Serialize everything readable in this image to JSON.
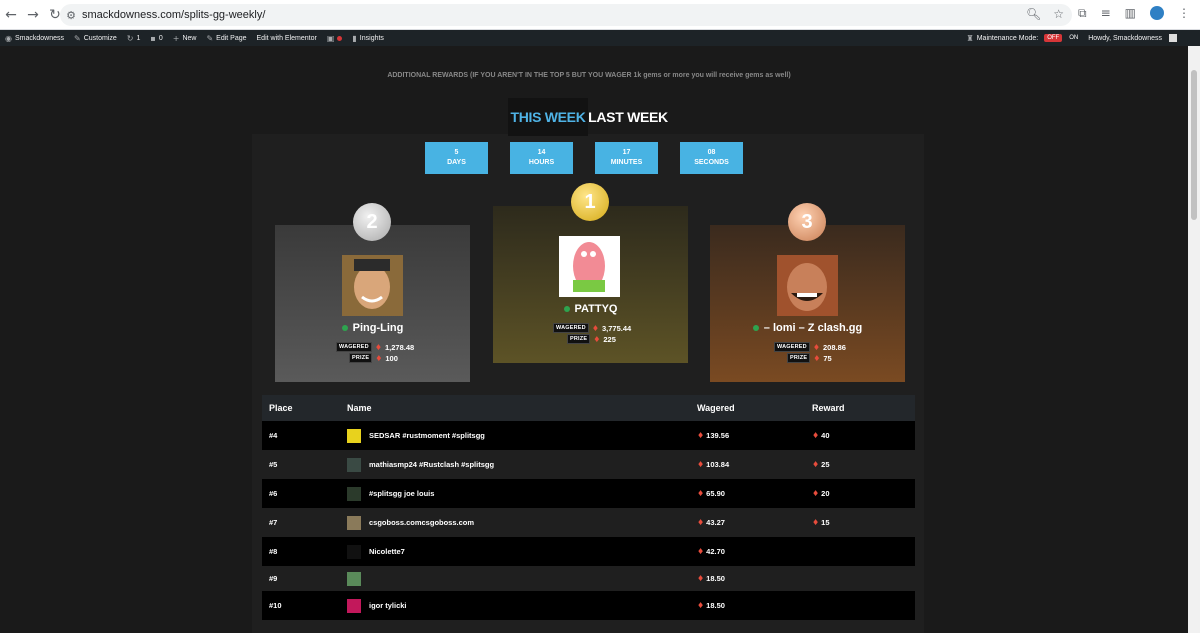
{
  "browser": {
    "url": "smackdowness.com/splits-gg-weekly/",
    "back_glyph": "←",
    "forward_glyph": "→",
    "reload_glyph": "↻"
  },
  "adminbar": {
    "site": "Smackdowness",
    "customize": "Customize",
    "updates": "1",
    "comments": "0",
    "new": "New",
    "edit_page": "Edit Page",
    "edit_elementor": "Edit with Elementor",
    "insights": "Insights",
    "maintenance_label": "Maintenance Mode:",
    "maintenance_off": "OFF",
    "maintenance_on": "ON",
    "howdy": "Howdy, Smackdowness"
  },
  "notice": "ADDITIONAL REWARDS (IF YOU AREN'T IN THE TOP 5 BUT YOU WAGER 1k gems or more you will receive gems as well)",
  "tabs": {
    "this_week": "THIS WEEK",
    "last_week": "LAST WEEK"
  },
  "countdown": [
    {
      "value": "5",
      "unit": "DAYS"
    },
    {
      "value": "14",
      "unit": "HOURS"
    },
    {
      "value": "17",
      "unit": "MINUTES"
    },
    {
      "value": "08",
      "unit": "SECONDS"
    }
  ],
  "podium": {
    "first": {
      "rank": "1",
      "name": "PATTYQ",
      "wagered_label": "WAGERED",
      "wagered": "3,775.44",
      "prize_label": "PRIZE",
      "prize": "225"
    },
    "second": {
      "rank": "2",
      "name": "Ping-Ling",
      "wagered_label": "WAGERED",
      "wagered": "1,278.48",
      "prize_label": "PRIZE",
      "prize": "100"
    },
    "third": {
      "rank": "3",
      "name": "– lomi – Z clash.gg",
      "wagered_label": "WAGERED",
      "wagered": "208.86",
      "prize_label": "PRIZE",
      "prize": "75"
    }
  },
  "table": {
    "headers": {
      "place": "Place",
      "name": "Name",
      "wagered": "Wagered",
      "reward": "Reward"
    },
    "rows": [
      {
        "place": "#4",
        "name": "SEDSAR #rustmoment #splitsgg",
        "wagered": "139.56",
        "reward": "40",
        "avatar_color": "#e8d21d"
      },
      {
        "place": "#5",
        "name": "mathiasmp24 #Rustclash #splitsgg",
        "wagered": "103.84",
        "reward": "25",
        "avatar_color": "#3a4a44"
      },
      {
        "place": "#6",
        "name": "#splitsgg joe louis",
        "wagered": "65.90",
        "reward": "20",
        "avatar_color": "#2b3a2b"
      },
      {
        "place": "#7",
        "name": "csgoboss.comcsgoboss.com",
        "wagered": "43.27",
        "reward": "15",
        "avatar_color": "#8a7a5a"
      },
      {
        "place": "#8",
        "name": "Nicolette7",
        "wagered": "42.70",
        "reward": "",
        "avatar_color": "#111111"
      },
      {
        "place": "#9",
        "name": "",
        "wagered": "18.50",
        "reward": "",
        "avatar_color": "#5a8a5a"
      },
      {
        "place": "#10",
        "name": "igor tylicki",
        "wagered": "18.50",
        "reward": "",
        "avatar_color": "#c2185b"
      }
    ]
  },
  "colors": {
    "accent": "#48b3e3",
    "gem": "#e74c3c",
    "online": "#2ea44f"
  }
}
